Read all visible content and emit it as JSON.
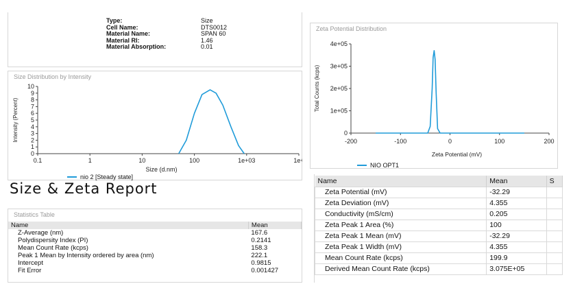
{
  "sample_info": [
    {
      "key": "Type:",
      "value": "Size"
    },
    {
      "key": "Cell Name:",
      "value": "DTS0012"
    },
    {
      "key": "Material Name:",
      "value": "SPAN 60"
    },
    {
      "key": "Material RI:",
      "value": "1.46"
    },
    {
      "key": "Material Absorption:",
      "value": "0.01"
    }
  ],
  "size_panel": {
    "title": "Size Distribution by Intensity",
    "ylabel": "Intensity (Percent)",
    "xlabel": "Size (d.nm)",
    "y_ticks": [
      "10",
      "9",
      "8",
      "7",
      "6",
      "5",
      "4",
      "3",
      "2",
      "1",
      "0"
    ],
    "x_ticks": [
      "0.1",
      "1",
      "10",
      "100",
      "1e+03",
      "1e+"
    ],
    "legend": "nio 2 [Steady state]"
  },
  "zeta_panel": {
    "title": "Zeta Potential Distribution",
    "ylabel": "Total Counts (kcps)",
    "xlabel": "Zeta Potential (mV)",
    "y_ticks": [
      "4e+05",
      "3e+05",
      "2e+05",
      "1e+05",
      "0"
    ],
    "x_ticks": [
      "-200",
      "-100",
      "0",
      "100",
      "200"
    ],
    "legend": "NIO OPT1"
  },
  "report_title": "Size & Zeta Report",
  "stats_table": {
    "title": "Statistics Table",
    "headers": [
      "Name",
      "Mean"
    ],
    "rows": [
      [
        "Z-Average (nm)",
        "167.6"
      ],
      [
        "Polydispersity Index (PI)",
        "0.2141"
      ],
      [
        "Mean Count Rate (kcps)",
        "158.3"
      ],
      [
        "Peak 1 Mean by Intensity ordered by area (nm)",
        "222.1"
      ],
      [
        "Intercept",
        "0.9815"
      ],
      [
        "Fit Error",
        "0.001427"
      ]
    ]
  },
  "zeta_table": {
    "headers": [
      "Name",
      "Mean",
      "S"
    ],
    "rows": [
      [
        "Zeta Potential (mV)",
        "-32.29"
      ],
      [
        "Zeta Deviation (mV)",
        "4.355"
      ],
      [
        "Conductivity (mS/cm)",
        "0.205"
      ],
      [
        "Zeta Peak 1 Area (%)",
        "100"
      ],
      [
        "Zeta Peak 1 Mean (mV)",
        "-32.29"
      ],
      [
        "Zeta Peak 1 Width (mV)",
        "4.355"
      ],
      [
        "Mean Count Rate (kcps)",
        "199.9"
      ],
      [
        "Derived Mean Count Rate (kcps)",
        "3.075E+05"
      ]
    ]
  },
  "colors": {
    "series": "#1f9bd9",
    "panel_border": "#d6d6d6",
    "header_bg": "#e6e6e6"
  },
  "chart_data": [
    {
      "type": "line",
      "title": "Size Distribution by Intensity",
      "xlabel": "Size (d.nm)",
      "ylabel": "Intensity (Percent)",
      "x_scale": "log",
      "xlim": [
        0.1,
        10000
      ],
      "ylim": [
        0,
        10
      ],
      "series": [
        {
          "name": "nio 2 [Steady state]",
          "x": [
            50,
            70,
            100,
            140,
            200,
            260,
            350,
            500,
            700,
            900
          ],
          "y": [
            0,
            2.0,
            6.0,
            8.8,
            9.5,
            9.0,
            7.2,
            4.0,
            1.2,
            0
          ]
        }
      ]
    },
    {
      "type": "line",
      "title": "Zeta Potential Distribution",
      "xlabel": "Zeta Potential (mV)",
      "ylabel": "Total Counts (kcps)",
      "xlim": [
        -200,
        200
      ],
      "ylim": [
        0,
        400000
      ],
      "series": [
        {
          "name": "NIO OPT1",
          "x": [
            -150,
            -45,
            -40,
            -36,
            -34,
            -32,
            -30,
            -28,
            -25,
            -20,
            150
          ],
          "y": [
            0,
            0,
            30000,
            200000,
            340000,
            370000,
            330000,
            180000,
            20000,
            0,
            0
          ]
        }
      ]
    }
  ]
}
